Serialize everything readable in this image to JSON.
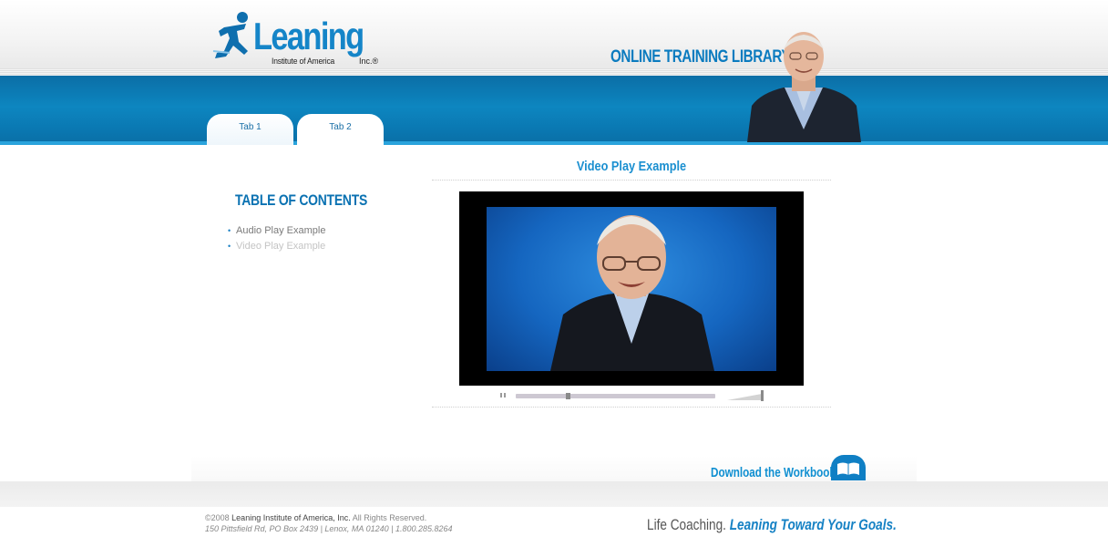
{
  "logo": {
    "word": "Leaning",
    "sub": "Institute of America",
    "inc": "Inc.®"
  },
  "header": {
    "library_title": "ONLINE TRAINING LIBRARY"
  },
  "tabs": [
    {
      "label": "Tab 1",
      "active": false
    },
    {
      "label": "Tab 2",
      "active": true
    }
  ],
  "toc": {
    "title": "TABLE OF CONTENTS",
    "items": [
      {
        "label": "Audio Play Example",
        "active": true
      },
      {
        "label": "Video Play Example",
        "active": false
      }
    ]
  },
  "video": {
    "title": "Video Play Example",
    "progress_fraction": 0.25,
    "volume_fraction": 0.9
  },
  "download": {
    "label": "Download the Workbook!"
  },
  "footer": {
    "copyright_prefix": "©2008",
    "company": "Leaning Institute of America, Inc.",
    "rights": "All Rights Reserved.",
    "address": "150 Pittsfield Rd, PO Box 2439  |  Lenox, MA 01240  |  1.800.285.8264",
    "tagline_plain": "Life Coaching.",
    "tagline_accent": "Leaning Toward Your Goals."
  },
  "colors": {
    "brand_blue": "#0d86c0",
    "accent_blue": "#1581c4"
  }
}
